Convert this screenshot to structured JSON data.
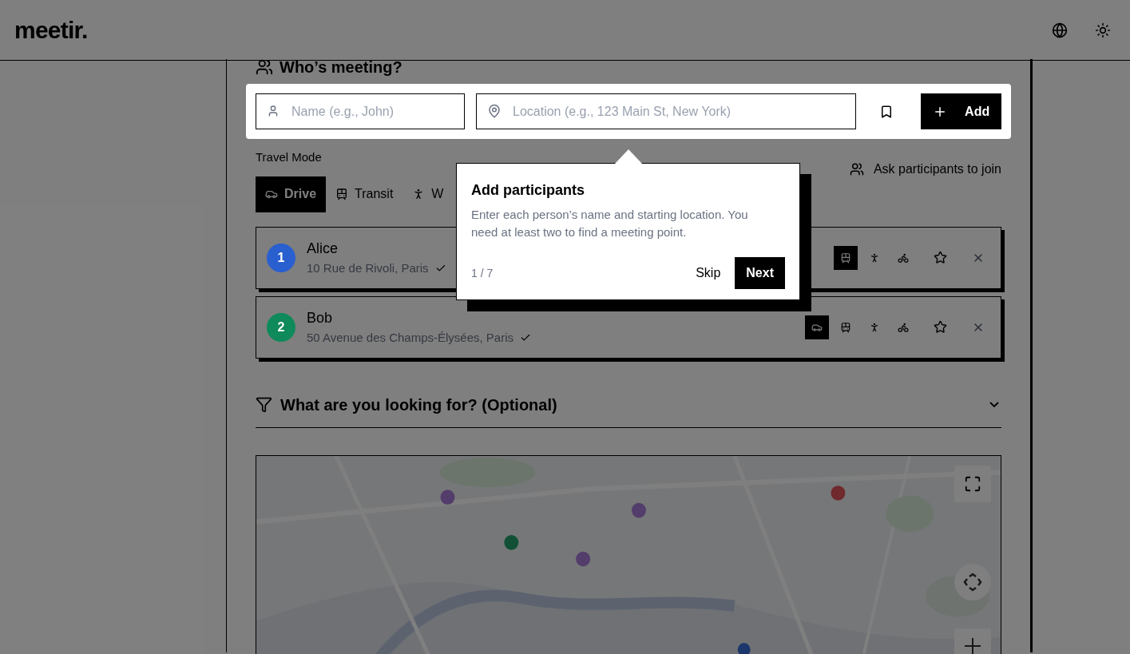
{
  "header": {
    "logo": "meetir."
  },
  "meeting": {
    "title": "Who’s meeting?",
    "name_field": {
      "placeholder": "Name (e.g., John)"
    },
    "location_field": {
      "placeholder": "Location (e.g., 123 Main St, New York)"
    },
    "add_button": "Add",
    "travel_mode_label": "Travel Mode",
    "travel_modes": [
      {
        "kind": "drive",
        "label": "Drive",
        "selected": true
      },
      {
        "kind": "transit",
        "label": "Transit",
        "selected": false
      },
      {
        "kind": "walk",
        "label": "W",
        "selected": false
      }
    ],
    "ask_link": "Ask participants to join",
    "participants": [
      {
        "number": "1",
        "name": "Alice",
        "address": "10 Rue de Rivoli, Paris",
        "color": "#2a5fcf",
        "modes": [
          {
            "kind": "transit",
            "selected": true
          },
          {
            "kind": "walk",
            "selected": false
          },
          {
            "kind": "bike",
            "selected": false
          }
        ]
      },
      {
        "number": "2",
        "name": "Bob",
        "address": "50 Avenue des Champs-Élysées, Paris",
        "color": "#0f8a5a",
        "modes": [
          {
            "kind": "drive",
            "selected": true
          },
          {
            "kind": "transit",
            "selected": false
          },
          {
            "kind": "walk",
            "selected": false
          },
          {
            "kind": "bike",
            "selected": false
          }
        ]
      }
    ]
  },
  "filters": {
    "title": "What are you looking for? (Optional)",
    "expanded": false
  },
  "tour": {
    "title": "Add participants",
    "body": "Enter each person’s name and starting location. You need at least two to find a meeting point.",
    "step": "1 / 7",
    "skip": "Skip",
    "next": "Next"
  }
}
